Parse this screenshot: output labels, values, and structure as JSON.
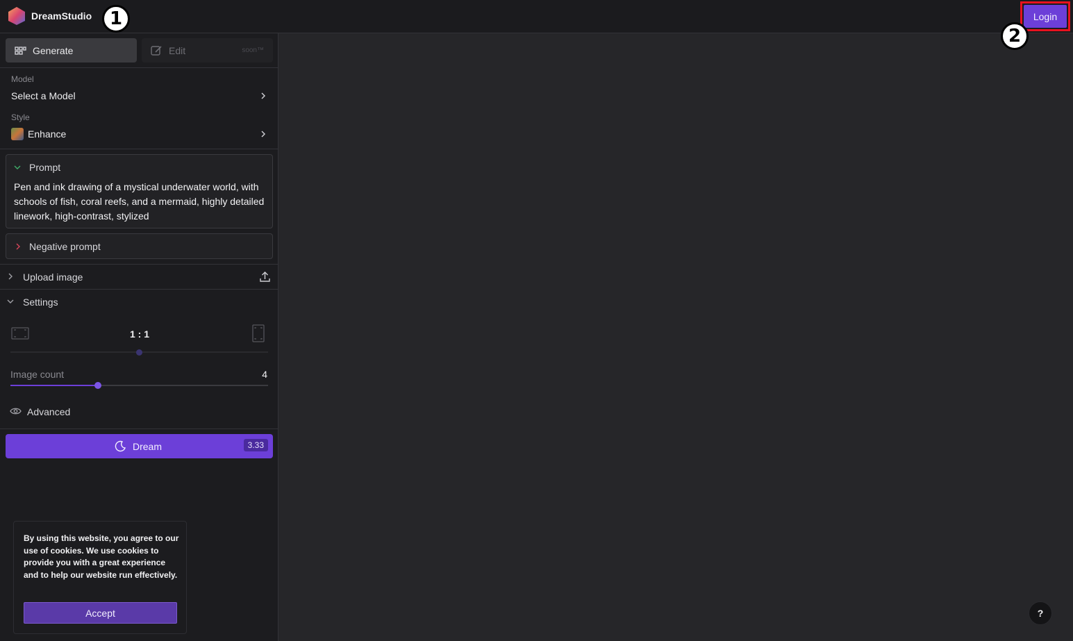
{
  "header": {
    "brand": "DreamStudio",
    "login_label": "Login",
    "marker_1": "1",
    "marker_2": "2"
  },
  "tabs": {
    "generate_label": "Generate",
    "edit_label": "Edit",
    "edit_badge": "soon™"
  },
  "model": {
    "label": "Model",
    "value": "Select a Model"
  },
  "style": {
    "label": "Style",
    "value": "Enhance"
  },
  "prompt": {
    "title": "Prompt",
    "text": "Pen and ink drawing of a mystical underwater world, with schools of fish, coral reefs, and a mermaid, highly detailed linework, high-contrast, stylized"
  },
  "negative_prompt": {
    "title": "Negative prompt"
  },
  "upload": {
    "label": "Upload image"
  },
  "settings": {
    "label": "Settings",
    "aspect_ratio": "1 : 1",
    "image_count_label": "Image count",
    "image_count_value": "4",
    "image_count_fraction": 0.34,
    "advanced_label": "Advanced"
  },
  "dream": {
    "label": "Dream",
    "cost": "3.33"
  },
  "cookie": {
    "text": "By using this website, you agree to our use of cookies. We use cookies to provide you with a great experience and to help our website run effectively.",
    "accept_label": "Accept"
  },
  "help": {
    "label": "?"
  },
  "colors": {
    "accent": "#6c3fd8",
    "highlight": "#e8121f"
  }
}
